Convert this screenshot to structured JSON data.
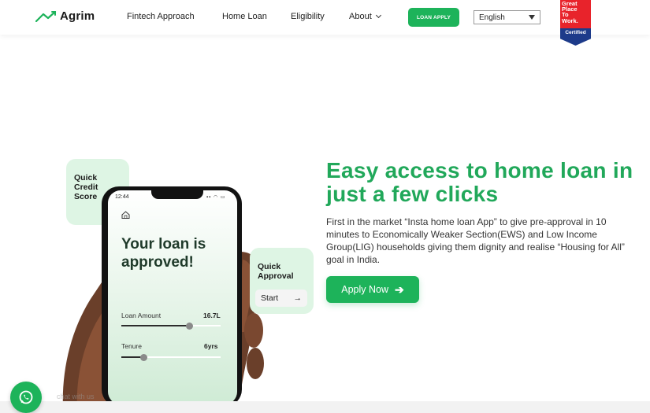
{
  "header": {
    "logo_text": "Agrim",
    "nav": {
      "fintech": "Fintech Approach",
      "home_loan": "Home Loan",
      "eligibility": "Eligibility",
      "about": "About"
    },
    "loan_apply_label": "LOAN APPLY",
    "language": "English",
    "badge": {
      "line1": "Great",
      "line2": "Place",
      "line3": "To",
      "line4": "Work.",
      "certified": "Certified"
    }
  },
  "hero": {
    "title": "Easy access to home loan in just a few clicks",
    "description": "First in the market “Insta home loan App” to give pre-approval in 10 minutes to Economically Weaker Section(EWS) and Low Income Group(LIG) households giving them dignity and realise “Housing for All” goal in India.",
    "cta_label": "Apply Now"
  },
  "illustration": {
    "quick_credit": [
      "Quick",
      "Credit",
      "Score"
    ],
    "quick_approval": [
      "Quick",
      "Approval"
    ],
    "start_label": "Start",
    "phone": {
      "time": "12:44",
      "heading": "Your loan is approved!",
      "loan_amount_label": "Loan Amount",
      "loan_amount_value": "16.7L",
      "loan_amount_level": 0.69,
      "tenure_label": "Tenure",
      "tenure_value": "6yrs",
      "tenure_level": 0.23
    }
  },
  "chat_label": "chat with us",
  "colors": {
    "brand_green": "#1db35a",
    "title_green": "#21a85a",
    "card_green": "#def5e4"
  }
}
